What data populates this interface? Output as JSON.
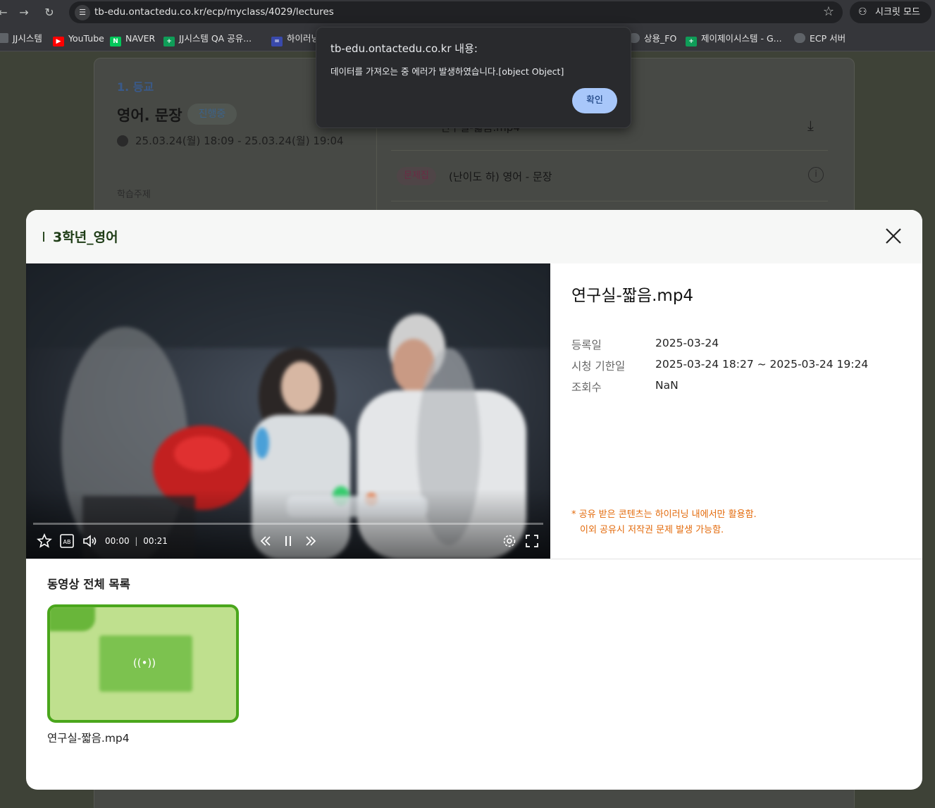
{
  "browser": {
    "url": "tb-edu.ontactedu.co.kr/ecp/myclass/4029/lectures",
    "incognito_label": "시크릿 모드",
    "bookmarks": [
      {
        "label": "JJ시스템",
        "color": "#5f6368"
      },
      {
        "label": "YouTube",
        "color": "#ff0000"
      },
      {
        "label": "NAVER",
        "color": "#03c75a"
      },
      {
        "label": "JJ시스템 QA 공유...",
        "color": "#0f9d58"
      },
      {
        "label": "하이러닝",
        "color": "#3949ab"
      },
      {
        "label": "상용_FO",
        "color": "#5f6368"
      },
      {
        "label": "제이제이시스템 - G...",
        "color": "#0f9d58"
      },
      {
        "label": "ECP 서버",
        "color": "#5f6368"
      }
    ]
  },
  "background_page": {
    "section_label": "1. 등교",
    "course_title": "영어. 문장",
    "status_badge": "진행중",
    "date_range": "25.03.24(월) 18:09 - 25.03.24(월) 19:04",
    "topic_label": "학습주제",
    "row1_file": "연구실-짧음.mp4",
    "row2_tag": "문제집",
    "row2_title": "(난이도 하) 영어 - 문장"
  },
  "alert": {
    "title": "tb-edu.ontactedu.co.kr 내용:",
    "message": "데이터를 가져오는 중 에러가 발생하였습니다.[object Object]",
    "ok_label": "확인"
  },
  "modal": {
    "title": "3학년_영어",
    "video": {
      "current_time": "00:00",
      "duration": "00:21",
      "progress": 0.0
    },
    "file_title": "연구실-짧음.mp4",
    "meta": [
      {
        "label": "등록일",
        "value": "2025-03-24"
      },
      {
        "label": "시청 기한일",
        "value": "2025-03-24 18:27 ~ 2025-03-24 19:24"
      },
      {
        "label": "조회수",
        "value": "NaN"
      }
    ],
    "notice_line1": "* 공유 받은 콘텐츠는 하이러닝 내에서만 활용함.",
    "notice_line2": "이외 공유시 저작권 문제 발생 가능함.",
    "list_title": "동영상 전체 목록",
    "list_items": [
      {
        "label": "연구실-짧음.mp4"
      }
    ],
    "accent_color": "#4aa61c",
    "notice_color": "#e36a0b"
  }
}
